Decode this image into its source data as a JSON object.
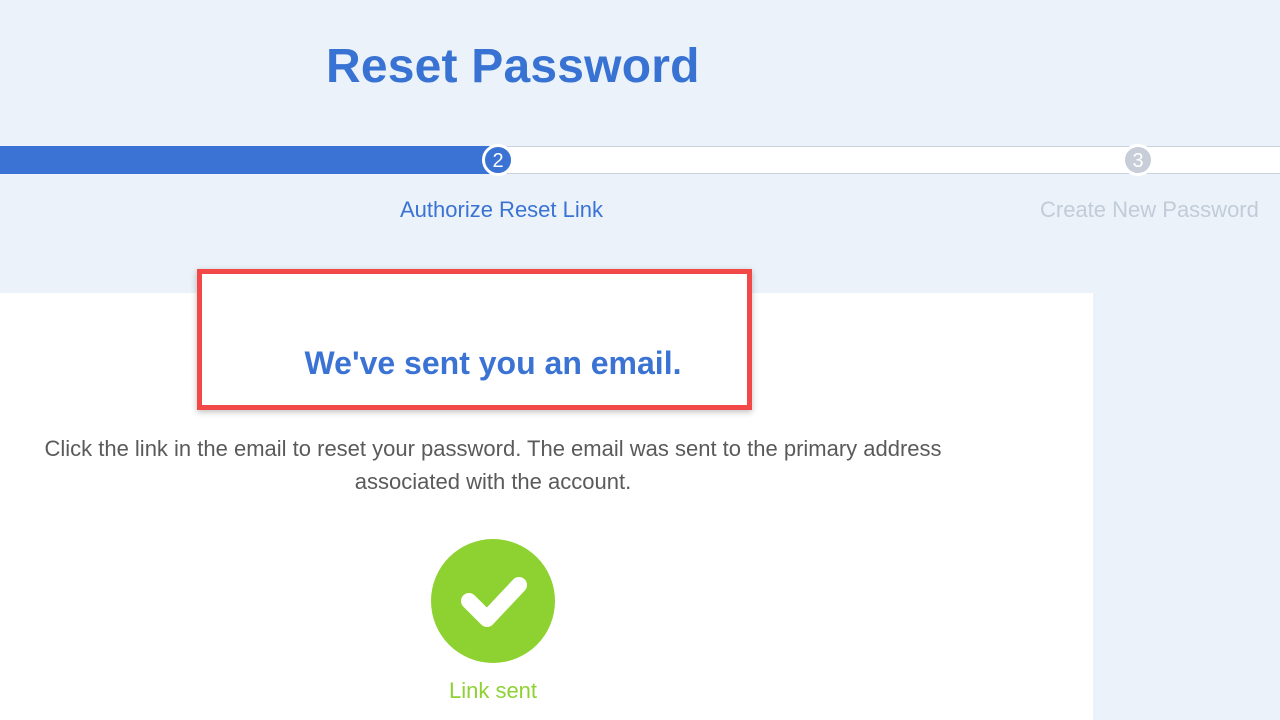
{
  "header": {
    "title": "Reset Password"
  },
  "steps": [
    {
      "number": "2",
      "label": "Authorize Reset Link",
      "state": "active"
    },
    {
      "number": "3",
      "label": "Create New Password",
      "state": "pending"
    }
  ],
  "progress": {
    "completed_fraction": 0.39
  },
  "card": {
    "heading": "We've sent you an email.",
    "instructions": "Click the link in the email to reset your password. The email was sent to the primary address associated with the account.",
    "status_icon": "checkmark-icon",
    "status_label": "Link sent"
  },
  "colors": {
    "accent": "#3a73d4",
    "success": "#8ed232",
    "highlight": "#f24848",
    "background": "#ebf2f9"
  }
}
